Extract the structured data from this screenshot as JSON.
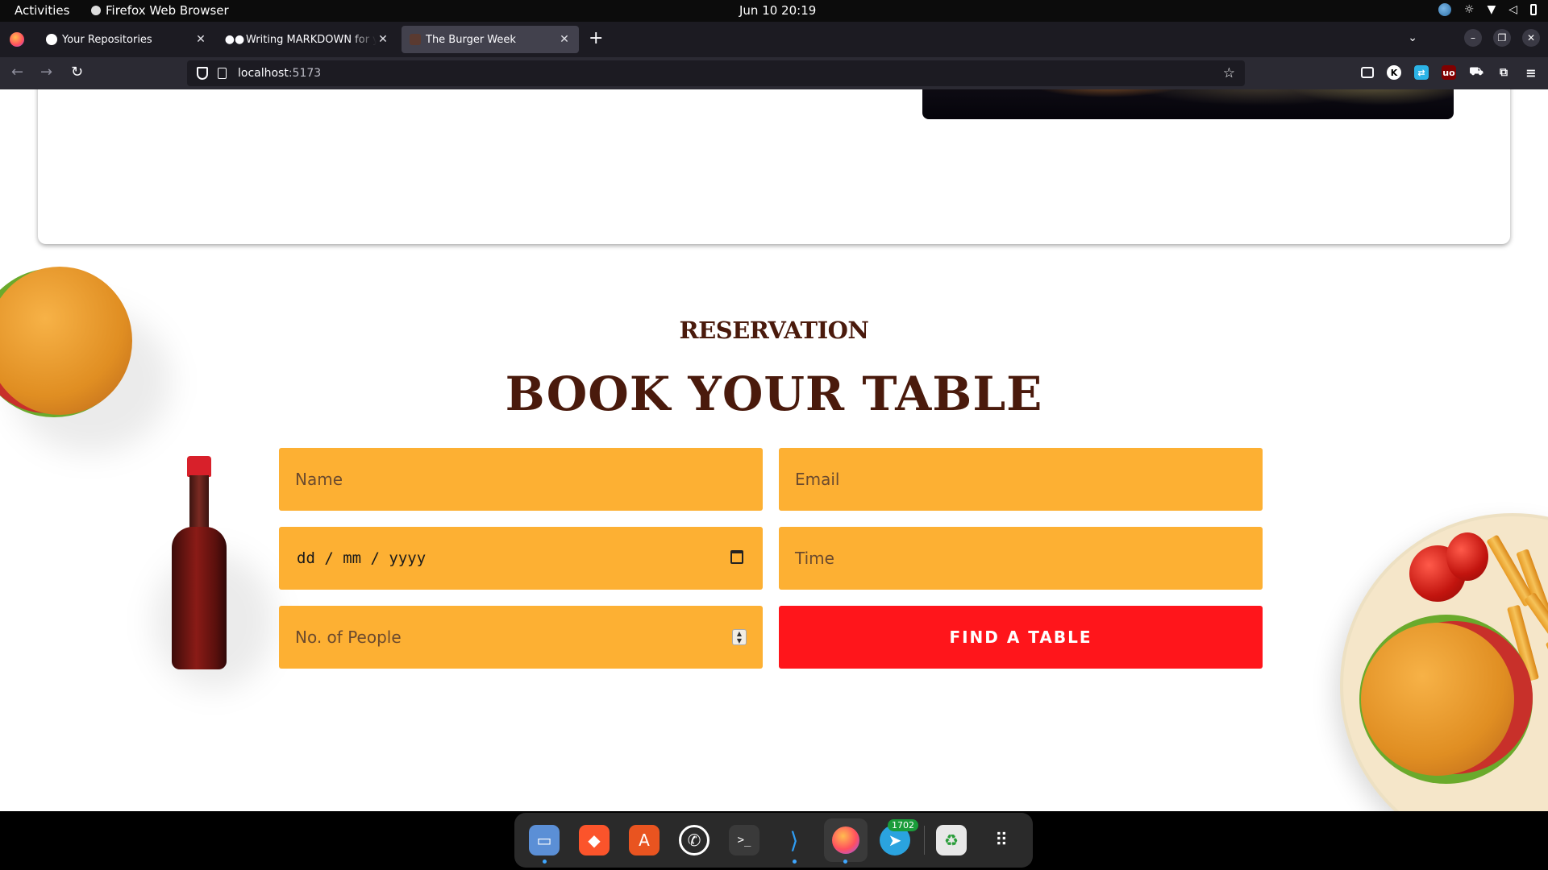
{
  "system": {
    "activities": "Activities",
    "app_name": "Firefox Web Browser",
    "clock": "Jun 10  20:19"
  },
  "browser": {
    "tabs": [
      {
        "title": "Your Repositories",
        "icon": "github-icon",
        "active": false
      },
      {
        "title": "Writing MARKDOWN for your",
        "icon": "medium-icon",
        "active": false
      },
      {
        "title": "The Burger Week",
        "icon": "burger-favicon",
        "active": true
      }
    ],
    "url_host": "localhost",
    "url_port": ":5173"
  },
  "page": {
    "eyebrow": "RESERVATION",
    "title": "BOOK YOUR TABLE",
    "form": {
      "name_placeholder": "Name",
      "email_placeholder": "Email",
      "date_placeholder": "dd / mm / yyyy",
      "time_placeholder": "Time",
      "people_placeholder": "No. of People",
      "submit_label": "FIND A TABLE"
    },
    "colors": {
      "heading": "#4a1a0c",
      "field_bg": "#fdb033",
      "button_bg": "#ff151b"
    }
  },
  "dock": {
    "apps": [
      "files-icon",
      "brave-icon",
      "app-center-icon",
      "whatsapp-icon",
      "terminal-icon",
      "vscode-icon",
      "firefox-icon",
      "telegram-icon",
      "trash-icon",
      "app-grid-icon"
    ],
    "telegram_badge": "1702"
  }
}
